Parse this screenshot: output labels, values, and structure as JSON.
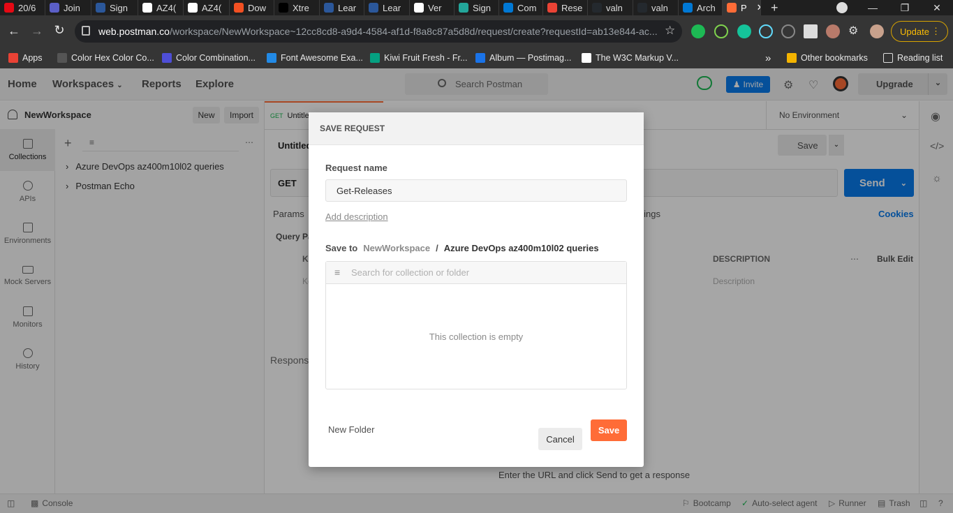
{
  "browser": {
    "tabs": [
      {
        "label": "20/6",
        "color": "#e50914"
      },
      {
        "label": "Join",
        "color": "#5b5fc7"
      },
      {
        "label": "Sign",
        "color": "#2b579a"
      },
      {
        "label": "AZ4(",
        "color": "#ffffff"
      },
      {
        "label": "AZ4(",
        "color": "#ffffff"
      },
      {
        "label": "Dow",
        "color": "#f25022"
      },
      {
        "label": "Xtre",
        "color": "#000000"
      },
      {
        "label": "Lear",
        "color": "#2b579a"
      },
      {
        "label": "Lear",
        "color": "#2b579a"
      },
      {
        "label": "Ver",
        "color": "#ffffff"
      },
      {
        "label": "Sign",
        "color": "#23a69a"
      },
      {
        "label": "Com",
        "color": "#0078d4"
      },
      {
        "label": "Rese",
        "color": "#ea4335"
      },
      {
        "label": "valn",
        "color": "#24292e"
      },
      {
        "label": "valn",
        "color": "#24292e"
      },
      {
        "label": "Arch",
        "color": "#0078d4"
      },
      {
        "label": "P",
        "color": "#ff6c37"
      }
    ],
    "new_tab": "+",
    "url": "web.postman.co",
    "url_path": "/workspace/NewWorkspace~12cc8cd8-a9d4-4584-af1d-f8a8c87a5d8d/request/create?requestId=ab13e844-ac...",
    "update_label": "Update",
    "bookmarks": [
      {
        "label": "Apps",
        "color": "#e94235"
      },
      {
        "label": "Color Hex Color Co...",
        "color": "#555555"
      },
      {
        "label": "Color Combination...",
        "color": "#4e4ed6"
      },
      {
        "label": "Font Awesome Exa...",
        "color": "#228ae6"
      },
      {
        "label": "Kiwi Fruit Fresh - Fr...",
        "color": "#05a081"
      },
      {
        "label": "Album — Postimag...",
        "color": "#1a73e8"
      },
      {
        "label": "The W3C Markup V...",
        "color": "#ffffff"
      }
    ],
    "bookmarks_more": "»",
    "other_bookmarks": "Other bookmarks",
    "reading_list": "Reading list"
  },
  "header": {
    "nav": [
      "Home",
      "Workspaces",
      "Reports",
      "Explore"
    ],
    "search_placeholder": "Search Postman",
    "invite_label": "Invite",
    "upgrade_label": "Upgrade"
  },
  "sidebar": {
    "workspace_name": "NewWorkspace",
    "new_label": "New",
    "import_label": "Import",
    "nav": [
      "Collections",
      "APIs",
      "Environments",
      "Mock Servers",
      "Monitors",
      "History"
    ],
    "collections": [
      "Azure DevOps az400m10l02 queries",
      "Postman Echo"
    ]
  },
  "main": {
    "tab_method": "GET",
    "tab_title": "Untitled Request",
    "environment": "No Environment",
    "request_title": "Untitled Request",
    "save_label": "Save",
    "method": "GET",
    "send_label": "Send",
    "subtabs": [
      "Params",
      "Settings"
    ],
    "cookies": "Cookies",
    "query_params": "Query Params",
    "col_key": "KEY",
    "col_desc": "DESCRIPTION",
    "bulk_edit": "Bulk Edit",
    "key_placeholder": "Key",
    "desc_placeholder": "Description",
    "response": "Response",
    "empty_hint": "Enter the URL and click Send to get a response"
  },
  "footer": {
    "console": "Console",
    "bootcamp": "Bootcamp",
    "autoselect": "Auto-select agent",
    "runner": "Runner",
    "trash": "Trash"
  },
  "modal": {
    "title": "SAVE REQUEST",
    "request_name_label": "Request name",
    "request_name_value": "Get-Releases",
    "add_description": "Add description",
    "save_to_label": "Save to",
    "workspace": "NewWorkspace",
    "separator": "/",
    "collection": "Azure DevOps az400m10l02 queries",
    "search_placeholder": "Search for collection or folder",
    "empty_text": "This collection is empty",
    "new_folder": "New Folder",
    "cancel": "Cancel",
    "save": "Save"
  },
  "colors": {
    "accent": "#ff6c37",
    "invite": "#097bed",
    "send": "#097bed"
  }
}
